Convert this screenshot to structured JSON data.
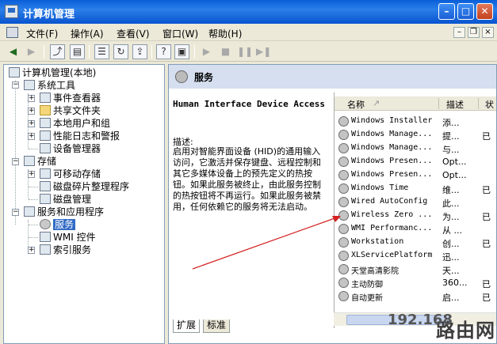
{
  "window": {
    "title": "计算机管理"
  },
  "menu": [
    {
      "label": "文件(F)"
    },
    {
      "label": "操作(A)"
    },
    {
      "label": "查看(V)"
    },
    {
      "label": "窗口(W)"
    },
    {
      "label": "帮助(H)"
    }
  ],
  "tree": {
    "root": "计算机管理(本地)",
    "items": [
      {
        "label": "系统工具",
        "level": 1,
        "expanded": true,
        "icon": "tools-icon"
      },
      {
        "label": "事件查看器",
        "level": 2,
        "expanded": false,
        "icon": "event-viewer-icon"
      },
      {
        "label": "共享文件夹",
        "level": 2,
        "expanded": false,
        "icon": "shared-folder-icon"
      },
      {
        "label": "本地用户和组",
        "level": 2,
        "expanded": false,
        "icon": "users-icon"
      },
      {
        "label": "性能日志和警报",
        "level": 2,
        "expanded": false,
        "icon": "performance-icon"
      },
      {
        "label": "设备管理器",
        "level": 2,
        "expanded": null,
        "icon": "device-manager-icon"
      },
      {
        "label": "存储",
        "level": 1,
        "expanded": true,
        "icon": "storage-icon"
      },
      {
        "label": "可移动存储",
        "level": 2,
        "expanded": false,
        "icon": "removable-storage-icon"
      },
      {
        "label": "磁盘碎片整理程序",
        "level": 2,
        "expanded": null,
        "icon": "defrag-icon"
      },
      {
        "label": "磁盘管理",
        "level": 2,
        "expanded": null,
        "icon": "disk-management-icon"
      },
      {
        "label": "服务和应用程序",
        "level": 1,
        "expanded": true,
        "icon": "services-apps-icon"
      },
      {
        "label": "服务",
        "level": 2,
        "expanded": null,
        "icon": "services-icon",
        "selected": true
      },
      {
        "label": "WMI 控件",
        "level": 2,
        "expanded": null,
        "icon": "wmi-icon"
      },
      {
        "label": "索引服务",
        "level": 2,
        "expanded": false,
        "icon": "indexing-icon"
      }
    ]
  },
  "pane": {
    "title": "服务",
    "service_title": "Human Interface Device Access",
    "desc_label": "描述:",
    "description": "启用对智能界面设备 (HID)的通用输入访问，它激活并保存键盘、远程控制和其它多媒体设备上的预先定义的热按钮。如果此服务被终止，由此服务控制的热按钮将不再运行。如果此服务被禁用，任何依赖它的服务将无法启动。"
  },
  "list": {
    "columns": [
      "名称",
      "描述",
      "状"
    ],
    "rows": [
      {
        "name": "Windows Installer",
        "desc": "添...",
        "state": ""
      },
      {
        "name": "Windows Manage...",
        "desc": "提...",
        "state": "已"
      },
      {
        "name": "Windows Manage...",
        "desc": "与...",
        "state": ""
      },
      {
        "name": "Windows Presen...",
        "desc": "Opt...",
        "state": ""
      },
      {
        "name": "Windows Presen...",
        "desc": "Opt...",
        "state": ""
      },
      {
        "name": "Windows Time",
        "desc": "维...",
        "state": "已"
      },
      {
        "name": "Wired AutoConfig",
        "desc": "此...",
        "state": ""
      },
      {
        "name": "Wireless Zero ...",
        "desc": "为...",
        "state": "已"
      },
      {
        "name": "WMI Performanc...",
        "desc": "从 ...",
        "state": ""
      },
      {
        "name": "Workstation",
        "desc": "创...",
        "state": "已"
      },
      {
        "name": "XLServicePlatform",
        "desc": "迅...",
        "state": ""
      },
      {
        "name": "天堂高清影院",
        "desc": "天...",
        "state": ""
      },
      {
        "name": "主动防御",
        "desc": "360...",
        "state": "已"
      },
      {
        "name": "自动更新",
        "desc": "启...",
        "state": "已"
      }
    ]
  },
  "tabs": [
    {
      "label": "扩展"
    },
    {
      "label": "标准"
    }
  ],
  "watermark": {
    "main": "路由网",
    "sub": "192.168"
  },
  "colors": {
    "title_bar": "#0a5fd8",
    "selection": "#316ac5",
    "arrow": "#d42020"
  }
}
